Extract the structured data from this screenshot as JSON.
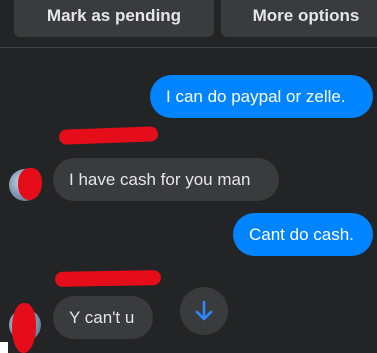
{
  "header": {
    "pending_label": "Mark as pending",
    "more_label": "More options"
  },
  "messages": [
    {
      "direction": "outgoing",
      "text": "I can do paypal or zelle."
    },
    {
      "direction": "incoming",
      "text": "I have cash for you man"
    },
    {
      "direction": "outgoing",
      "text": "Cant do cash."
    },
    {
      "direction": "incoming",
      "text": "Y can't u"
    }
  ],
  "icons": {
    "scroll": "arrow-down-icon"
  },
  "colors": {
    "background": "#232425",
    "outgoing_bubble": "#0084ff",
    "incoming_bubble": "#3a3b3c",
    "button_bg": "#3a3b3c",
    "redaction": "#e60d1b",
    "arrow": "#2d88ff"
  }
}
